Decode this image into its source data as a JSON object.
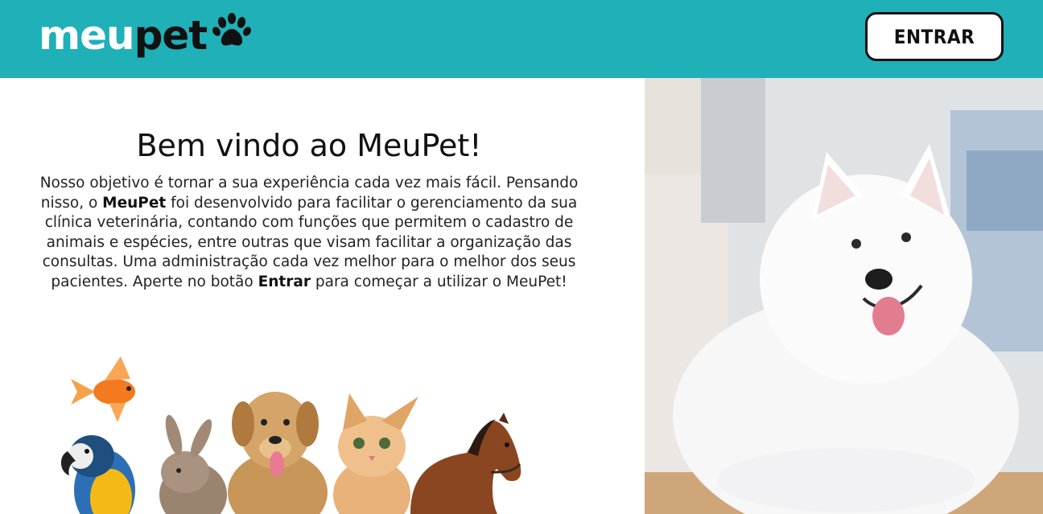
{
  "header": {
    "logo_part1": "meu",
    "logo_part2": "pet",
    "logo_icon": "paw-icon",
    "enter_label": "ENTRAR",
    "bg_color": "#20b0b8"
  },
  "main": {
    "title": "Bem vindo ao MeuPet!",
    "desc_part1": "Nosso objetivo é tornar a sua experiência cada vez mais fácil. Pensando nisso, o ",
    "desc_brand": "MeuPet",
    "desc_part2": " foi desenvolvido para facilitar o gerenciamento da sua clínica veterinária, contando com funções que permitem o cadastro de animais e espécies, entre outras que visam facilitar a organização das consultas. Uma administração cada vez melhor para o melhor dos seus pacientes. Aperte no botão ",
    "desc_cta": "Entrar",
    "desc_part3": " para começar a utilizar o MeuPet!"
  },
  "images": {
    "animals": [
      "goldfish",
      "parrot",
      "rabbit",
      "dog",
      "cat",
      "horse"
    ],
    "hero": "white-samoyed-dog"
  }
}
